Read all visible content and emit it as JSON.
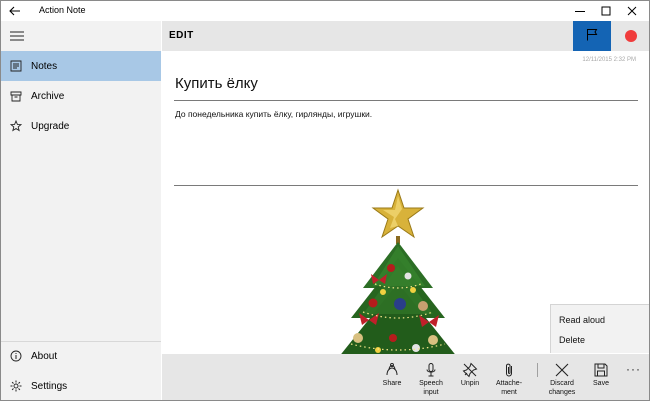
{
  "window": {
    "title": "Action Note"
  },
  "sidebar": {
    "items": [
      {
        "label": "Notes"
      },
      {
        "label": "Archive"
      },
      {
        "label": "Upgrade"
      }
    ],
    "bottom_items": [
      {
        "label": "About"
      },
      {
        "label": "Settings"
      }
    ]
  },
  "header": {
    "title": "EDIT"
  },
  "note": {
    "timestamp": "12/11/2015 2:32 PM",
    "title": "Купить ёлку",
    "body": "До понедельника купить ёлку, гирлянды, игрушки."
  },
  "context_menu": {
    "items": [
      "Read aloud",
      "Delete"
    ]
  },
  "command_bar": {
    "share": "Share",
    "speech_input": [
      "Speech",
      "input"
    ],
    "unpin": "Unpin",
    "attachment": [
      "Attache-",
      "ment"
    ],
    "discard": [
      "Discard",
      "changes"
    ],
    "save": "Save",
    "more": "···"
  },
  "colors": {
    "accent": "#1464b4",
    "selected_nav": "#a8c8e6",
    "record": "#f03c3c"
  }
}
